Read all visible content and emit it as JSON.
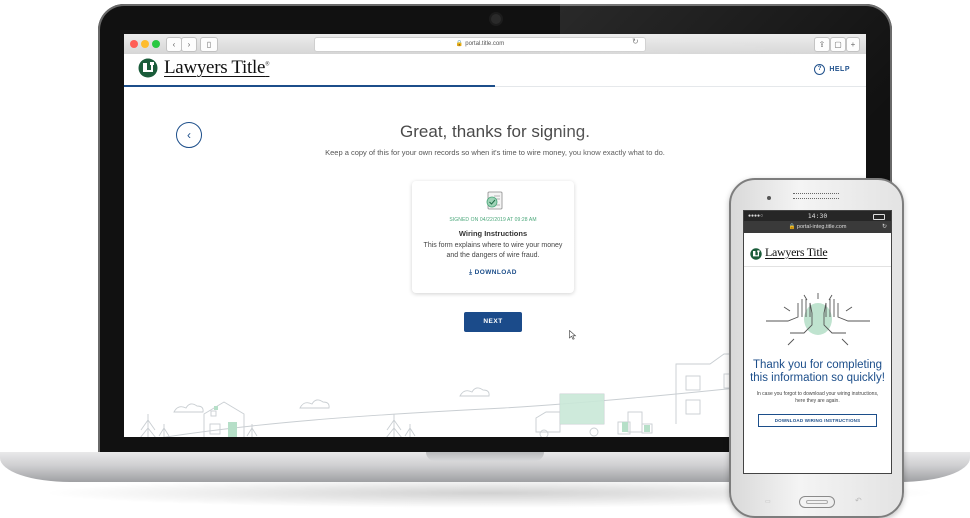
{
  "browser": {
    "url": "portal.title.com",
    "lock_glyph": "🔒"
  },
  "site": {
    "logo_text": "Lawyers Title",
    "logo_registered": "®",
    "help_label": "HELP",
    "help_glyph": "?",
    "progress_fraction": 0.5
  },
  "main": {
    "back_glyph": "‹",
    "headline": "Great, thanks for signing.",
    "subline": "Keep a copy of this for your own records so when it's time to wire money, you know exactly what to do.",
    "card": {
      "signed_text": "SIGNED ON 04/22/2019 AT 09:28 AM",
      "title": "Wiring Instructions",
      "description": "This form explains where to wire your money and the dangers of wire fraud.",
      "download_label": "DOWNLOAD",
      "download_glyph": "⤓"
    },
    "next_label": "NEXT"
  },
  "phone": {
    "status_signal": "●●●●○",
    "time": "14:30",
    "url": "portal-integ.title.com",
    "reload_glyph": "↻",
    "logo_text": "Lawyers Title",
    "thanks": "Thank you for completing this information so quickly!",
    "copy": "In case you forgot to download your wiring instructions, here they are again.",
    "download_label": "DOWNLOAD WIRING INSTRUCTIONS",
    "menu_glyph": "▭",
    "back_glyph": "↶"
  },
  "colors": {
    "brand_blue": "#1c4e8a",
    "success_green": "#4aa77a",
    "button_blue": "#1b4b8a"
  },
  "icons": [
    "lock-icon",
    "help-icon",
    "back-arrow-icon",
    "document-check-icon",
    "download-icon",
    "cursor-icon",
    "high-five-icon",
    "reload-icon"
  ]
}
